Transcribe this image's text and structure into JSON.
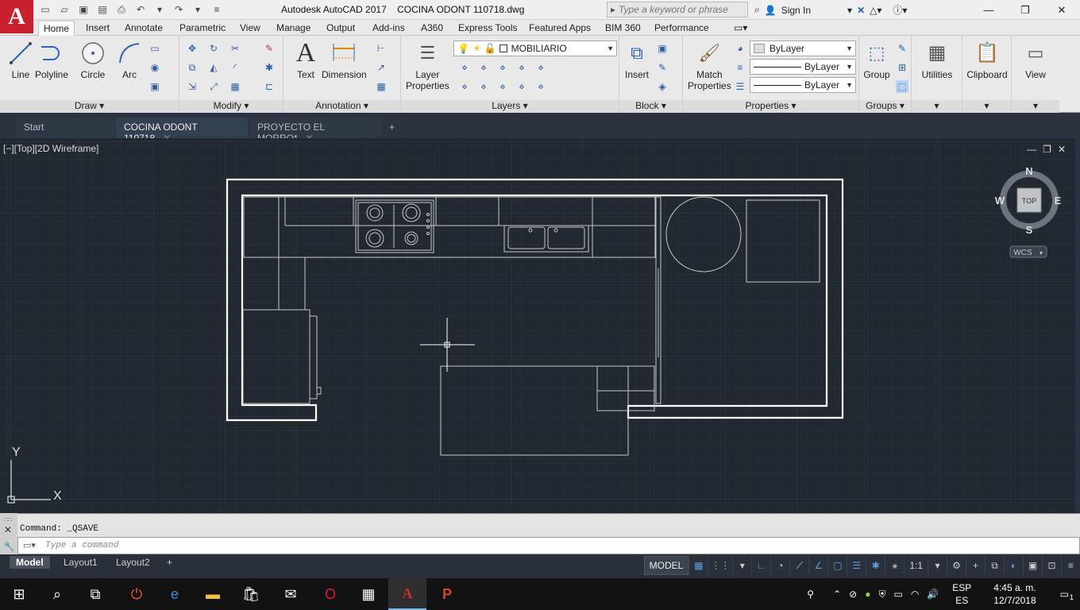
{
  "app": {
    "title": "Autodesk AutoCAD 2017",
    "document": "COCINA ODONT 110718.dwg",
    "logo_letter": "A",
    "search_placeholder": "Type a keyword or phrase",
    "sign_in": "Sign In"
  },
  "ribbon_tabs": [
    "Home",
    "Insert",
    "Annotate",
    "Parametric",
    "View",
    "Manage",
    "Output",
    "Add-ins",
    "A360",
    "Express Tools",
    "Featured Apps",
    "BIM 360",
    "Performance"
  ],
  "panels": {
    "draw": {
      "title": "Draw",
      "line": "Line",
      "polyline": "Polyline",
      "circle": "Circle",
      "arc": "Arc"
    },
    "modify": {
      "title": "Modify"
    },
    "annotation": {
      "title": "Annotation",
      "text": "Text",
      "dimension": "Dimension"
    },
    "layers": {
      "title": "Layers",
      "layer_properties_1": "Layer",
      "layer_properties_2": "Properties",
      "current_layer": "MOBILIARIO"
    },
    "block": {
      "title": "Block",
      "insert": "Insert"
    },
    "properties": {
      "title": "Properties",
      "match_1": "Match",
      "match_2": "Properties",
      "color": "ByLayer",
      "linetype": "ByLayer",
      "lineweight": "ByLayer"
    },
    "groups": {
      "title": "Groups",
      "group": "Group"
    },
    "utilities": "Utilities",
    "clipboard": "Clipboard",
    "view": "View"
  },
  "file_tabs": {
    "start": "Start",
    "tab1": "COCINA ODONT 110718",
    "tab2": "PROYECTO EL MORRO*"
  },
  "viewport": {
    "label": "[−][Top][2D Wireframe]",
    "compass": {
      "n": "N",
      "s": "S",
      "e": "E",
      "w": "W",
      "top": "TOP",
      "wcs": "WCS"
    },
    "ucs_x": "X",
    "ucs_y": "Y"
  },
  "command": {
    "history": "Command:  _QSAVE",
    "placeholder": "Type a command"
  },
  "layout_tabs": [
    "Model",
    "Layout1",
    "Layout2"
  ],
  "status": {
    "model": "MODEL",
    "scale": "1:1"
  },
  "taskbar": {
    "lang_1": "ESP",
    "lang_2": "ES",
    "time": "4:45 a. m.",
    "date": "12/7/2018",
    "notifications": "1"
  }
}
